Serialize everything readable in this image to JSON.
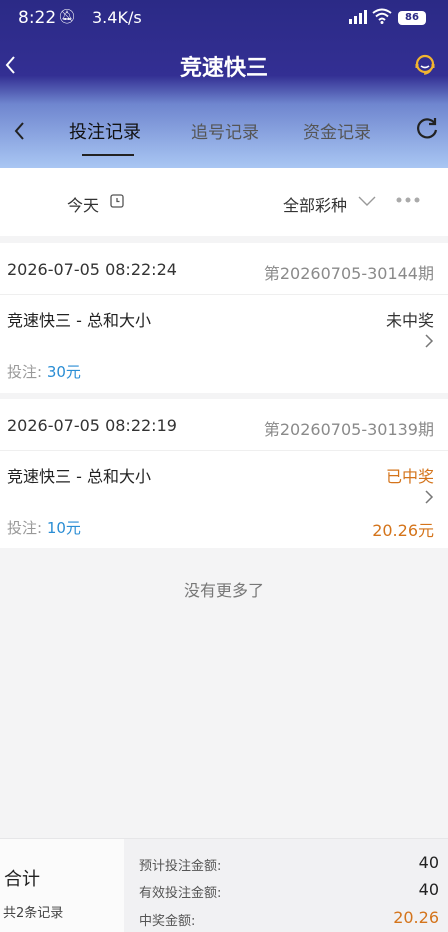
{
  "status_bar": {
    "time": "8:22",
    "speed": "3.4K/s",
    "battery": "86"
  },
  "header": {
    "title": "竞速快三"
  },
  "tabs": [
    {
      "label": "投注记录",
      "active": true
    },
    {
      "label": "追号记录",
      "active": false
    },
    {
      "label": "资金记录",
      "active": false
    }
  ],
  "filter": {
    "date": "今天",
    "lottery_type": "全部彩种"
  },
  "records": [
    {
      "datetime": "2026-07-05 08:22:24",
      "period": "第20260705-30144期",
      "game": "竞速快三 - 总和大小",
      "result": "未中奖",
      "result_color": "#333333",
      "bet_label": "投注:",
      "bet_amount": "30元",
      "win_amount": ""
    },
    {
      "datetime": "2026-07-05 08:22:19",
      "period": "第20260705-30139期",
      "game": "竞速快三 - 总和大小",
      "result": "已中奖",
      "result_color": "#d4741b",
      "bet_label": "投注:",
      "bet_amount": "10元",
      "win_amount": "20.26元"
    }
  ],
  "no_more": "没有更多了",
  "summary": {
    "title": "合计",
    "count": "共2条记录",
    "expected_label": "预计投注金额:",
    "expected_value": "40",
    "valid_label": "有效投注金额:",
    "valid_value": "40",
    "win_label": "中奖金额:",
    "win_value": "20.26"
  },
  "colors": {
    "accent_blue": "#2a8dd4",
    "win_orange": "#d4741b",
    "header_top": "#2b2a86"
  }
}
